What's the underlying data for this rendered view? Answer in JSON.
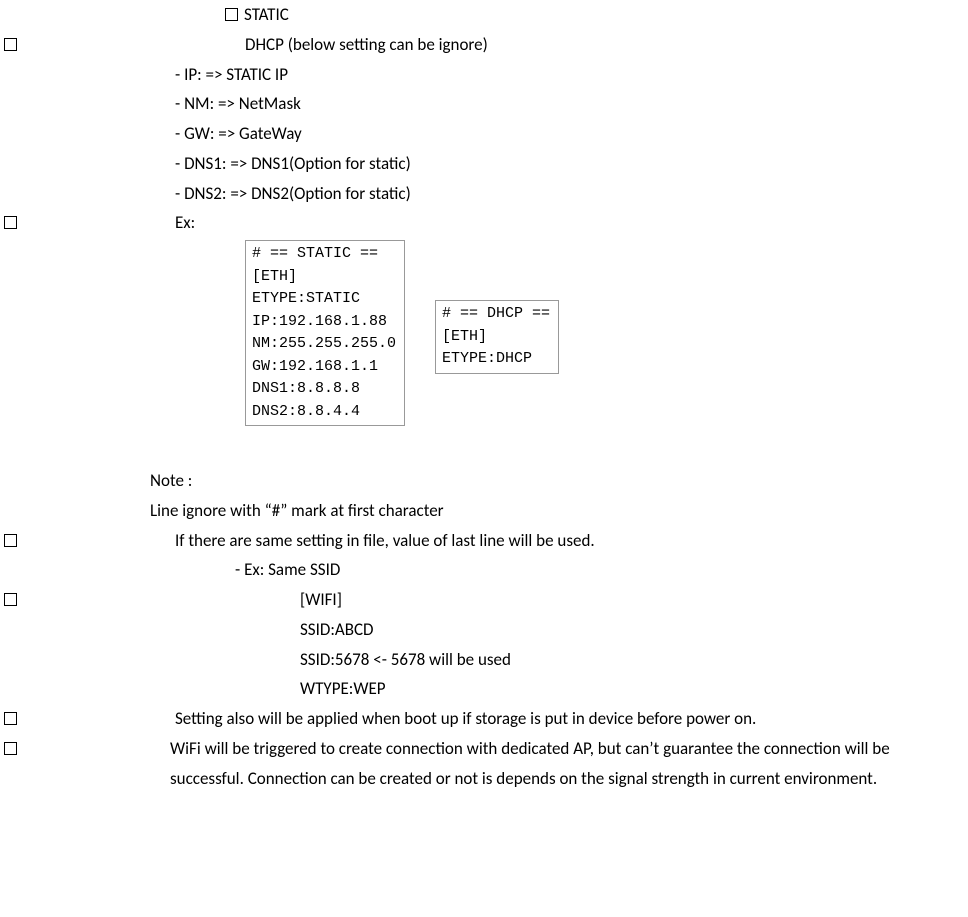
{
  "line_static": "STATIC",
  "line_dhcp": "DHCP (below setting can be ignore)",
  "fields": [
    "IP: => STATIC IP",
    "NM: => NetMask",
    "GW: => GateWay",
    "DNS1: => DNS1(Option for static)",
    "DNS2: => DNS2(Option for static)"
  ],
  "ex_label": "Ex:",
  "code_static": "# == STATIC ==\n[ETH]\nETYPE:STATIC\nIP:192.168.1.88\nNM:255.255.255.0\nGW:192.168.1.1\nDNS1:8.8.8.8\nDNS2:8.8.4.4",
  "code_dhcp": "# == DHCP ==\n[ETH]\nETYPE:DHCP",
  "note_label": "Note :",
  "note_line1": "Line ignore with “#” mark at first character",
  "note_line2": "If there are same setting in file, value of last line will be used.",
  "ex_same": "Ex: Same SSID",
  "ssid_lines": [
    "[WIFI]",
    "SSID:ABCD",
    "SSID:5678 <- 5678 will be used",
    "WTYPE:WEP"
  ],
  "note_line3": "Setting also will be applied when boot up if storage is put in device before power on.",
  "note_line4": "WiFi will be triggered to create connection with dedicated AP, but can’t guarantee the connection will be successful. Connection can be created or not is depends on the signal strength in current environment."
}
